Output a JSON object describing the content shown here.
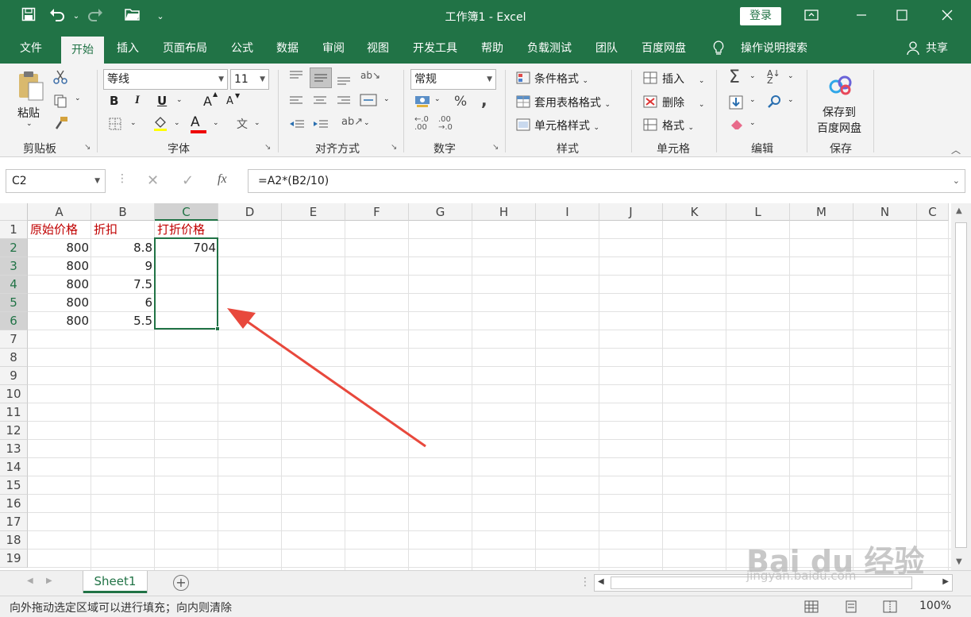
{
  "titlebar": {
    "title": "工作簿1  -  Excel",
    "login": "登录",
    "save_icon": "save-icon",
    "undo_icon": "undo-icon",
    "redo_icon": "redo-icon",
    "open_icon": "folder-icon"
  },
  "tabs": [
    "文件",
    "开始",
    "插入",
    "页面布局",
    "公式",
    "数据",
    "审阅",
    "视图",
    "开发工具",
    "帮助",
    "负载测试",
    "团队",
    "百度网盘",
    "操作说明搜索",
    "共享"
  ],
  "ribbon": {
    "clipboard": {
      "label": "剪贴板",
      "paste": "粘贴"
    },
    "font": {
      "label": "字体",
      "name": "等线",
      "size": "11",
      "bold": "B",
      "italic": "I",
      "underline": "U",
      "grow": "A",
      "shrink": "A",
      "color": "A",
      "phonetic": "文"
    },
    "align": {
      "label": "对齐方式"
    },
    "number": {
      "label": "数字",
      "format": "常规",
      "percent": "%",
      "comma": ","
    },
    "styles": {
      "label": "样式",
      "cond": "条件格式",
      "table": "套用表格格式",
      "cell": "单元格样式"
    },
    "cells": {
      "label": "单元格",
      "insert": "插入",
      "delete": "删除",
      "format": "格式"
    },
    "edit": {
      "label": "编辑",
      "sum": "Σ"
    },
    "save": {
      "label": "保存",
      "btn1": "保存到",
      "btn2": "百度网盘"
    }
  },
  "formula": {
    "namebox": "C2",
    "fx": "fx",
    "content": "=A2*(B2/10)"
  },
  "columns": [
    "A",
    "B",
    "C",
    "D",
    "E",
    "F",
    "G",
    "H",
    "I",
    "J",
    "K",
    "L",
    "M",
    "N",
    "C"
  ],
  "rows": [
    "1",
    "2",
    "3",
    "4",
    "5",
    "6",
    "7",
    "8",
    "9",
    "10",
    "11",
    "12",
    "13",
    "14",
    "15",
    "16",
    "17",
    "18",
    "19"
  ],
  "cells": {
    "A1": "原始价格",
    "B1": "折扣",
    "C1": "打折价格",
    "A2": "800",
    "B2": "8.8",
    "C2": "704",
    "A3": "800",
    "B3": "9",
    "A4": "800",
    "B4": "7.5",
    "A5": "800",
    "B5": "6",
    "A6": "800",
    "B6": "5.5"
  },
  "sheet": {
    "name": "Sheet1",
    "add": "+"
  },
  "status": {
    "text": "向外拖动选定区域可以进行填充；向内则清除",
    "zoom": "100%"
  },
  "watermark": {
    "text": "Bai du 经验",
    "url": "jingyan.baidu.com"
  },
  "colors": {
    "accent": "#217346",
    "red_text": "#c00000",
    "arrow": "#e8483c"
  }
}
